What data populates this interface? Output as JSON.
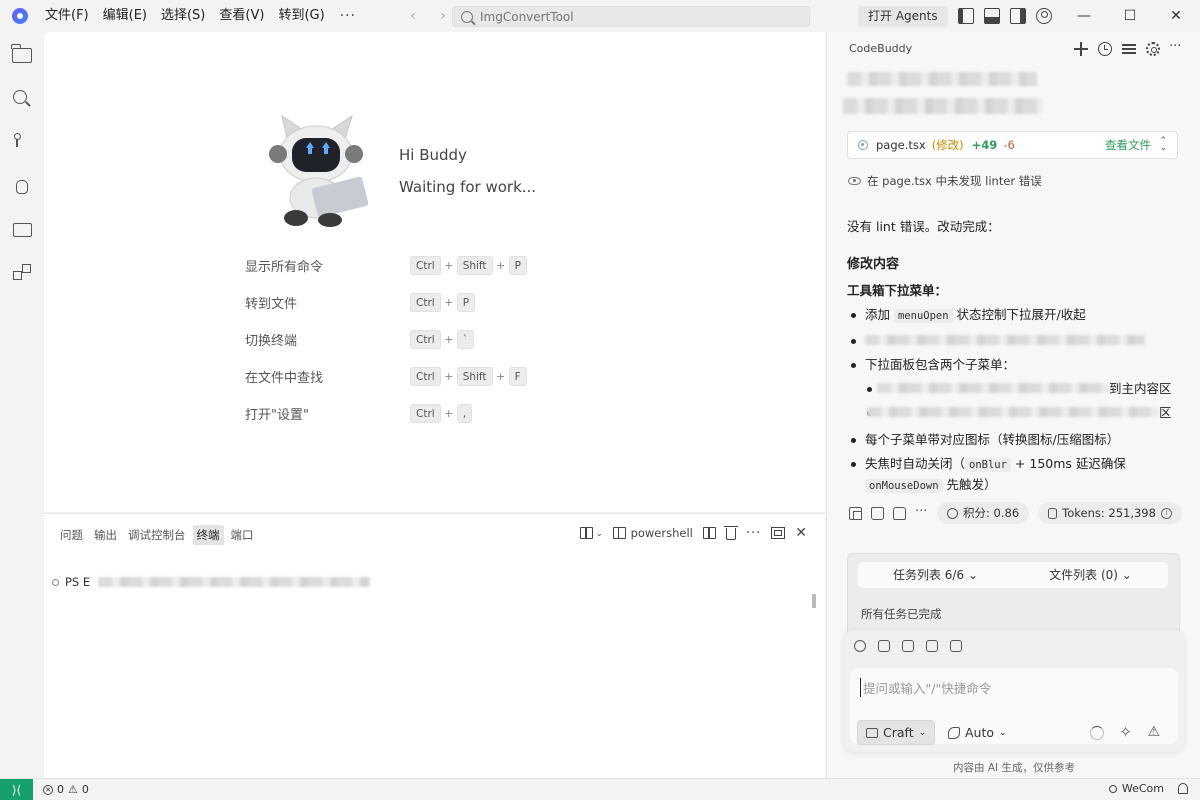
{
  "titlebar": {
    "menus": [
      "文件(F)",
      "编辑(E)",
      "选择(S)",
      "查看(V)",
      "转到(G)"
    ],
    "more": "···",
    "search_placeholder": "ImgConvertTool",
    "open_agents": "打开 Agents",
    "window_controls": {
      "minimize": "—",
      "maximize": "☐",
      "close": "✕"
    }
  },
  "activitybar": {
    "icons": [
      "explorer-icon",
      "search-icon",
      "source-control-icon",
      "debug-icon",
      "remote-explorer-icon",
      "extensions-icon"
    ]
  },
  "editor": {
    "greeting": "Hi Buddy",
    "status": "Waiting for work...",
    "commands": [
      {
        "label": "显示所有命令",
        "keys": [
          "Ctrl",
          "Shift",
          "P"
        ]
      },
      {
        "label": "转到文件",
        "keys": [
          "Ctrl",
          "P"
        ]
      },
      {
        "label": "切换终端",
        "keys": [
          "Ctrl",
          "`"
        ]
      },
      {
        "label": "在文件中查找",
        "keys": [
          "Ctrl",
          "Shift",
          "F"
        ]
      },
      {
        "label": "打开\"设置\"",
        "keys": [
          "Ctrl",
          ","
        ]
      }
    ]
  },
  "panel": {
    "tabs": [
      "问题",
      "输出",
      "调试控制台",
      "终端",
      "端口"
    ],
    "active_tab": "终端",
    "terminal_profile": "powershell",
    "prompt": "PS E"
  },
  "chat": {
    "title": "CodeBuddy",
    "file_change": {
      "name": "page.tsx",
      "status": "(修改)",
      "added": "+49",
      "removed": "-6",
      "view": "查看文件"
    },
    "lint": "在 page.tsx 中未发现 linter 错误",
    "intro": "没有 lint 错误。改动完成：",
    "heading": "修改内容",
    "subheading": "工具箱下拉菜单：",
    "items": [
      {
        "pre": "添加 ",
        "code": "menuOpen",
        "post": " 状态控制下拉展开/收起"
      },
      {
        "pre": "下拉面板包含两个子菜单："
      },
      {
        "pre": "到主内容区"
      },
      {
        "pre": "区"
      },
      {
        "pre": "每个子菜单带对应图标（转换图标/压缩图标）"
      },
      {
        "pre": "失焦时自动关闭（",
        "code": "onBlur",
        "post": " + 150ms 延迟确保",
        "code2": "onMouseDown",
        "post2": " 先触发）"
      }
    ],
    "credits": "积分: 0.86",
    "tokens": "Tokens: 251,398",
    "tasks_tab": "任务列表 6/6",
    "files_tab": "文件列表 (0)",
    "tasks_done": "所有任务已完成",
    "input_placeholder": "提问或输入\"/\"快捷命令",
    "mode": "Craft",
    "model": "Auto",
    "ai_note": "内容由 AI 生成，仅供参考"
  },
  "statusbar": {
    "errors": "0",
    "warnings": "0",
    "wecom": "WeCom"
  },
  "colors": {
    "accent_green": "#16a06b",
    "added": "#2a9d5c",
    "removed": "#d6533c",
    "modified": "#c98a00"
  }
}
